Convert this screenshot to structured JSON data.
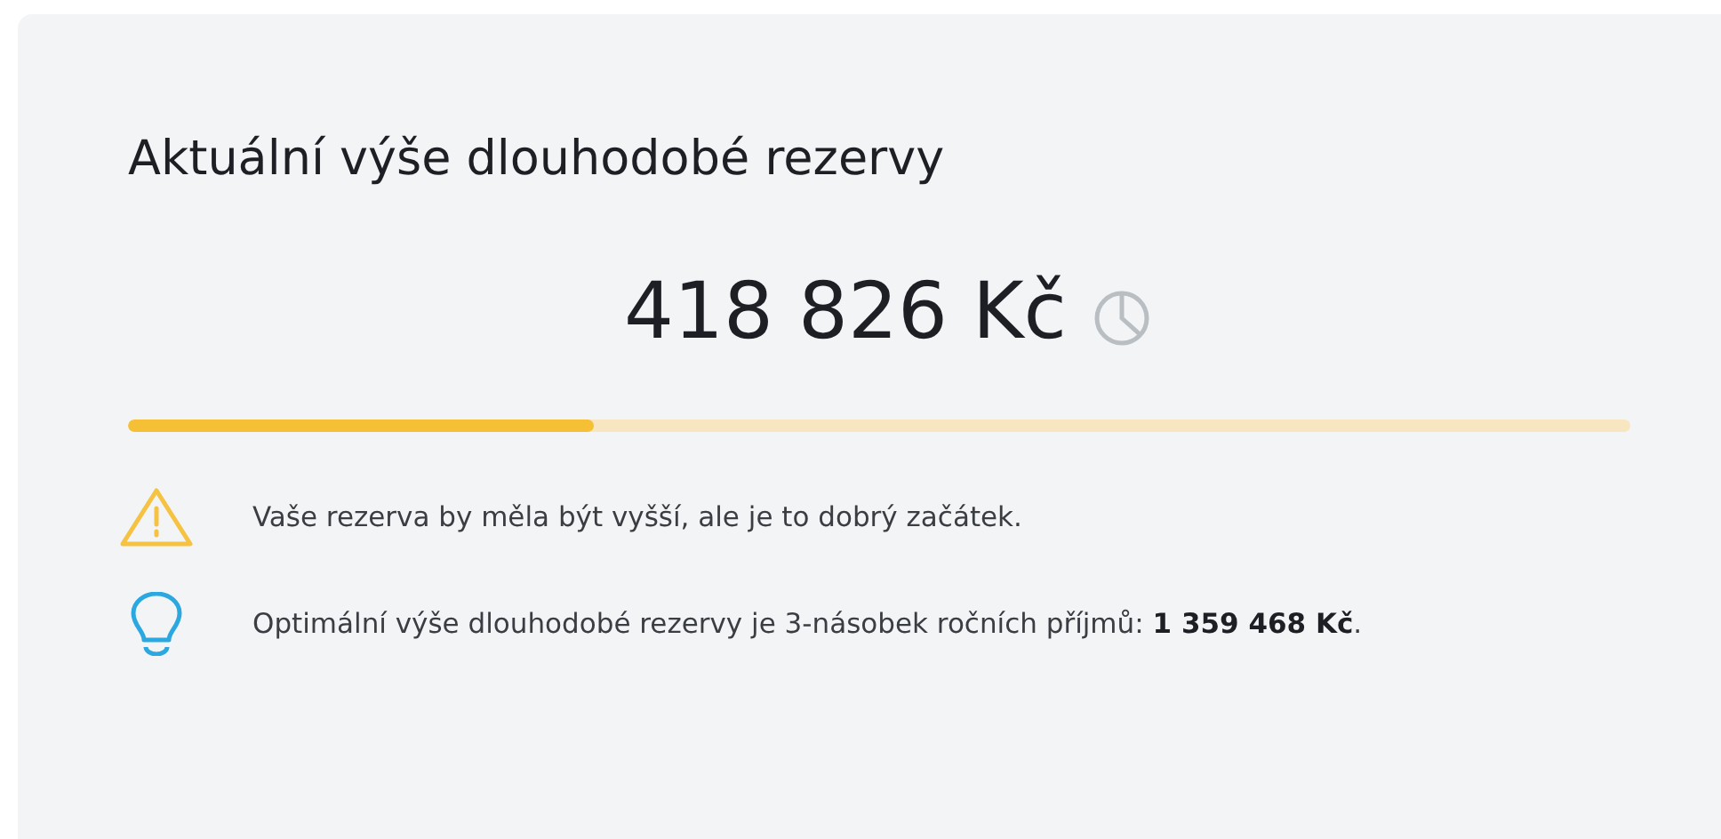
{
  "card": {
    "title": "Aktuální výše dlouhodobé rezervy",
    "amount": "418 826 Kč",
    "progress": {
      "level": 0.31
    },
    "messages": [
      {
        "kind": "warning",
        "text": "Vaše rezerva by měla být vyšší, ale je to dobrý začátek."
      },
      {
        "kind": "tip",
        "text": "Optimální výše dlouhodobé rezervy je 3-násobek ročních příjmů: **1 359 468 Kč**."
      }
    ]
  }
}
